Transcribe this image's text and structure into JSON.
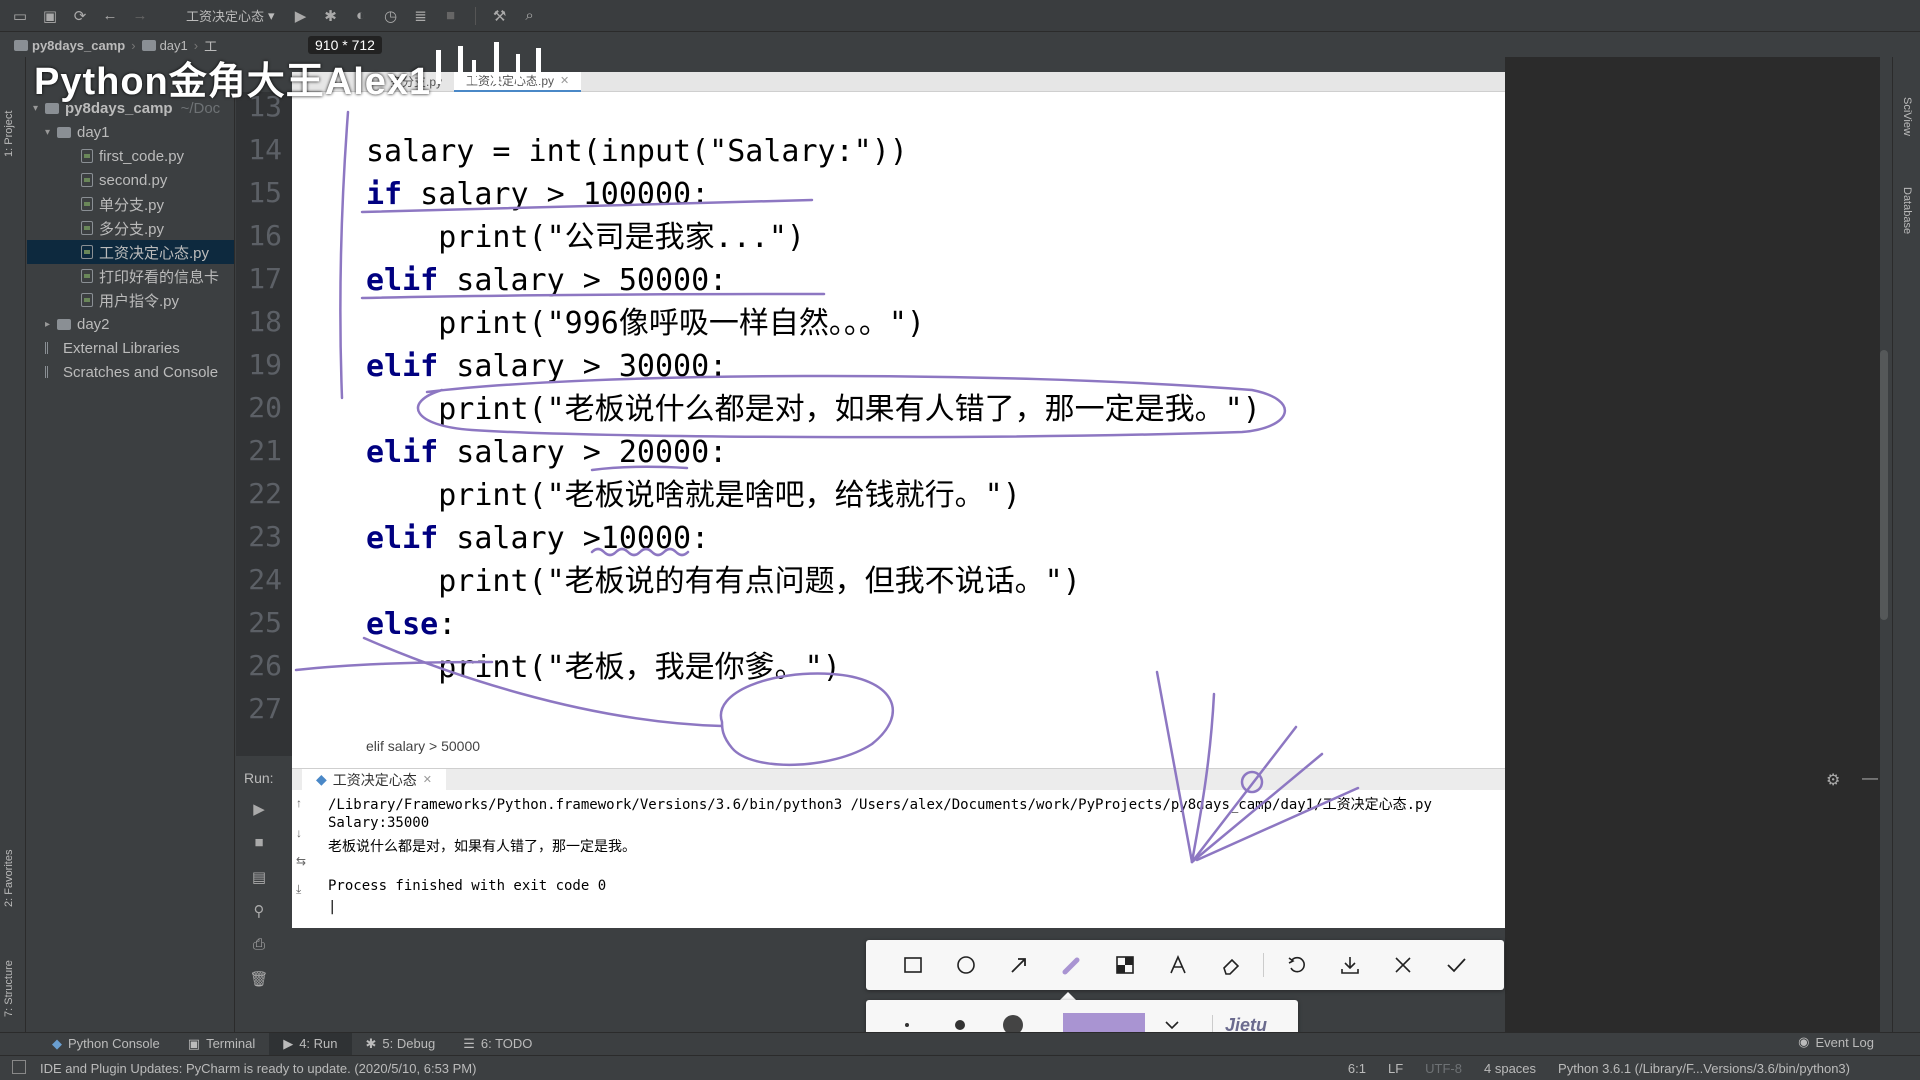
{
  "toolbar": {
    "run_config": "工资决定心态"
  },
  "navbar": {
    "project": "py8days_camp",
    "folder": "day1",
    "file_partial": "工"
  },
  "overlay": {
    "dimensions": "910 * 712",
    "watermark": "Python金角大王Alex1"
  },
  "left_strip": {
    "project_tab": "1: Project",
    "favorites_tab": "2: Favorites",
    "structure_tab": "7: Structure"
  },
  "project_tree": {
    "root": "py8days_camp",
    "root_path": "~/Doc",
    "items": [
      {
        "label": "day1",
        "kind": "folder"
      },
      {
        "label": "first_code.py",
        "kind": "file"
      },
      {
        "label": "second.py",
        "kind": "file"
      },
      {
        "label": "单分支.py",
        "kind": "file"
      },
      {
        "label": "多分支.py",
        "kind": "file"
      },
      {
        "label": "工资决定心态.py",
        "kind": "file",
        "selected": true
      },
      {
        "label": "打印好看的信息卡",
        "kind": "file"
      },
      {
        "label": "用户指令.py",
        "kind": "file"
      },
      {
        "label": "day2",
        "kind": "folder"
      },
      {
        "label": "External Libraries",
        "kind": "lib"
      },
      {
        "label": "Scratches and Console",
        "kind": "lib"
      }
    ]
  },
  "editor": {
    "tabs": [
      {
        "label": "多分支.py",
        "active": false
      },
      {
        "label": "工资决定心态.py",
        "active": true
      }
    ],
    "line_numbers": [
      "13",
      "14",
      "15",
      "16",
      "17",
      "18",
      "19",
      "20",
      "21",
      "22",
      "23",
      "24",
      "25",
      "26",
      "27"
    ],
    "lines": {
      "l14": "salary = int(input(\"Salary:\"))",
      "l15_kw": "if",
      "l15": " salary > 100000:",
      "l16": "    print(\"公司是我家...\")",
      "l17_kw": "elif",
      "l17": " salary > 50000:",
      "l18": "    print(\"996像呼吸一样自然。。。\")",
      "l19_kw": "elif",
      "l19": " salary > 30000:",
      "l20": "    print(\"老板说什么都是对，如果有人错了，那一定是我。\")",
      "l21_kw": "elif",
      "l21": " salary > 20000:",
      "l22": "    print(\"老板说啥就是啥吧，给钱就行。\")",
      "l23_kw": "elif",
      "l23": " salary >10000:",
      "l24": "    print(\"老板说的有有点问题，但我不说话。\")",
      "l25_kw": "else",
      "l25": ":",
      "l26": "    print(\"老板，我是你爹。\")"
    },
    "breadcrumb_hint": "elif salary > 50000"
  },
  "run_window": {
    "label": "Run:",
    "tab": "工资决定心态",
    "console": [
      "/Library/Frameworks/Python.framework/Versions/3.6/bin/python3 /Users/alex/Documents/work/PyProjects/py8days_camp/day1/工资决定心态.py",
      "Salary:35000",
      "老板说什么都是对，如果有人错了，那一定是我。",
      "",
      "Process finished with exit code 0"
    ]
  },
  "right_strip": {
    "sciview": "SciView",
    "database": "Database"
  },
  "jietu": {
    "brand": "Jietu",
    "accent": "#a994d2",
    "tools": [
      "rectangle-icon",
      "ellipse-icon",
      "arrow-icon",
      "pen-icon",
      "mosaic-icon",
      "text-icon",
      "eraser-icon",
      "undo-icon",
      "download-icon",
      "close-icon",
      "confirm-icon"
    ]
  },
  "bottom_bar": {
    "python_console": "Python Console",
    "terminal": "Terminal",
    "run": "4: Run",
    "debug": "5: Debug",
    "todo": "6: TODO",
    "event_log": "Event Log"
  },
  "status_bar": {
    "message": "IDE and Plugin Updates: PyCharm is ready to update. (2020/5/10, 6:53 PM)",
    "position": "6:1",
    "line_sep": "LF",
    "encoding": "UTF-8",
    "indent": "4 spaces",
    "interpreter": "Python 3.6.1 (/Library/F...Versions/3.6/bin/python3)"
  }
}
